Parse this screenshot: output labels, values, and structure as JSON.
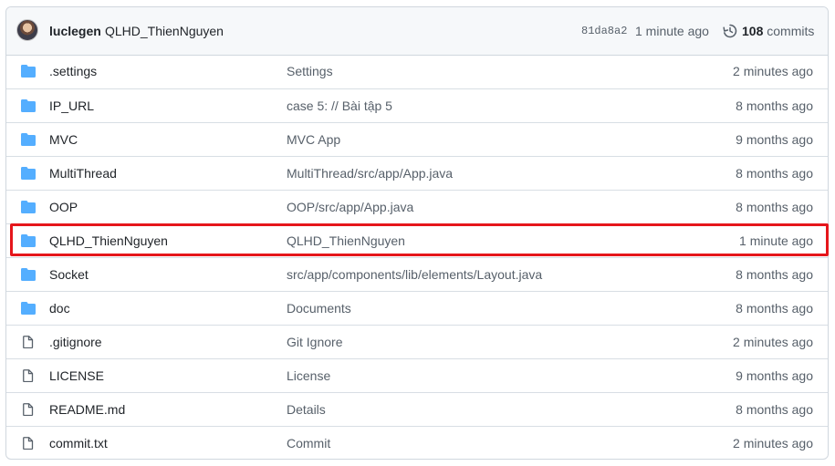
{
  "header": {
    "author": "luclegen",
    "commit_message": "QLHD_ThienNguyen",
    "sha": "81da8a2",
    "time": "1 minute ago",
    "commit_count": "108",
    "commits_label": "commits"
  },
  "colors": {
    "folder": "#54aeff",
    "highlight": "#e5161b",
    "muted": "#57606a"
  },
  "entries": [
    {
      "type": "folder",
      "name": ".settings",
      "message": "Settings",
      "time": "2 minutes ago"
    },
    {
      "type": "folder",
      "name": "IP_URL",
      "message": "case 5: // Bài tập 5",
      "time": "8 months ago"
    },
    {
      "type": "folder",
      "name": "MVC",
      "message": "MVC App",
      "time": "9 months ago"
    },
    {
      "type": "folder",
      "name": "MultiThread",
      "message": "MultiThread/src/app/App.java",
      "time": "8 months ago"
    },
    {
      "type": "folder",
      "name": "OOP",
      "message": "OOP/src/app/App.java",
      "time": "8 months ago"
    },
    {
      "type": "folder",
      "name": "QLHD_ThienNguyen",
      "message": "QLHD_ThienNguyen",
      "time": "1 minute ago"
    },
    {
      "type": "folder",
      "name": "Socket",
      "message": "src/app/components/lib/elements/Layout.java",
      "time": "8 months ago"
    },
    {
      "type": "folder",
      "name": "doc",
      "message": "Documents",
      "time": "8 months ago"
    },
    {
      "type": "file",
      "name": ".gitignore",
      "message": "Git Ignore",
      "time": "2 minutes ago"
    },
    {
      "type": "file",
      "name": "LICENSE",
      "message": "License",
      "time": "9 months ago"
    },
    {
      "type": "file",
      "name": "README.md",
      "message": "Details",
      "time": "8 months ago"
    },
    {
      "type": "file",
      "name": "commit.txt",
      "message": "Commit",
      "time": "2 minutes ago"
    }
  ],
  "highlighted_entry": "QLHD_ThienNguyen"
}
